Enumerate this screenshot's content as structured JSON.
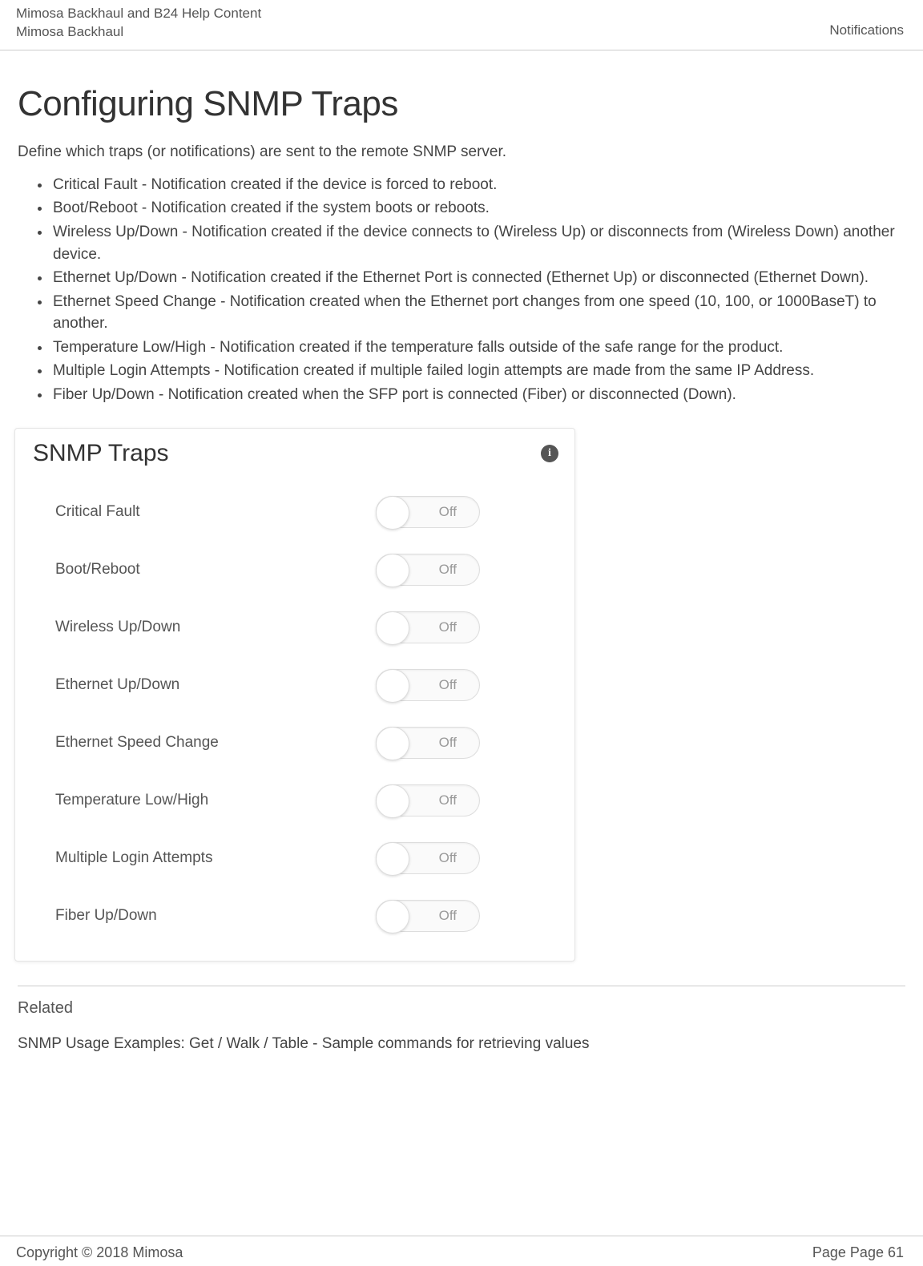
{
  "header": {
    "line1": "Mimosa Backhaul and B24 Help Content",
    "line2": "Mimosa Backhaul",
    "right": "Notifications"
  },
  "title": "Configuring SNMP Traps",
  "intro": "Define which traps (or notifications) are sent to the remote SNMP server.",
  "bullets": [
    "Critical Fault - Notification created if the device is forced to reboot.",
    "Boot/Reboot - Notification created if the system boots or reboots.",
    "Wireless Up/Down - Notification created if the device connects to (Wireless Up) or disconnects from (Wireless Down) another device.",
    "Ethernet Up/Down - Notification created if the Ethernet Port is connected (Ethernet Up) or disconnected (Ethernet Down).",
    "Ethernet Speed Change - Notification created when the Ethernet port changes from one speed (10, 100, or 1000BaseT) to another.",
    "Temperature Low/High - Notification created if the temperature falls outside of the safe range for the product.",
    "Multiple Login Attempts - Notification created if multiple failed login attempts are made from the same IP Address.",
    "Fiber Up/Down - Notification created when the SFP port is connected (Fiber) or disconnected (Down)."
  ],
  "panel": {
    "title": "SNMP Traps",
    "off_label": "Off",
    "rows": [
      "Critical Fault",
      "Boot/Reboot",
      "Wireless Up/Down",
      "Ethernet Up/Down",
      "Ethernet Speed Change",
      "Temperature Low/High",
      "Multiple Login Attempts",
      "Fiber Up/Down"
    ]
  },
  "related": {
    "heading": "Related",
    "link_text": "SNMP Usage Examples: Get / Walk / Table",
    "suffix": " - Sample commands for retrieving values"
  },
  "footer": {
    "copyright": "Copyright © 2018 Mimosa",
    "page": "Page Page 61"
  }
}
